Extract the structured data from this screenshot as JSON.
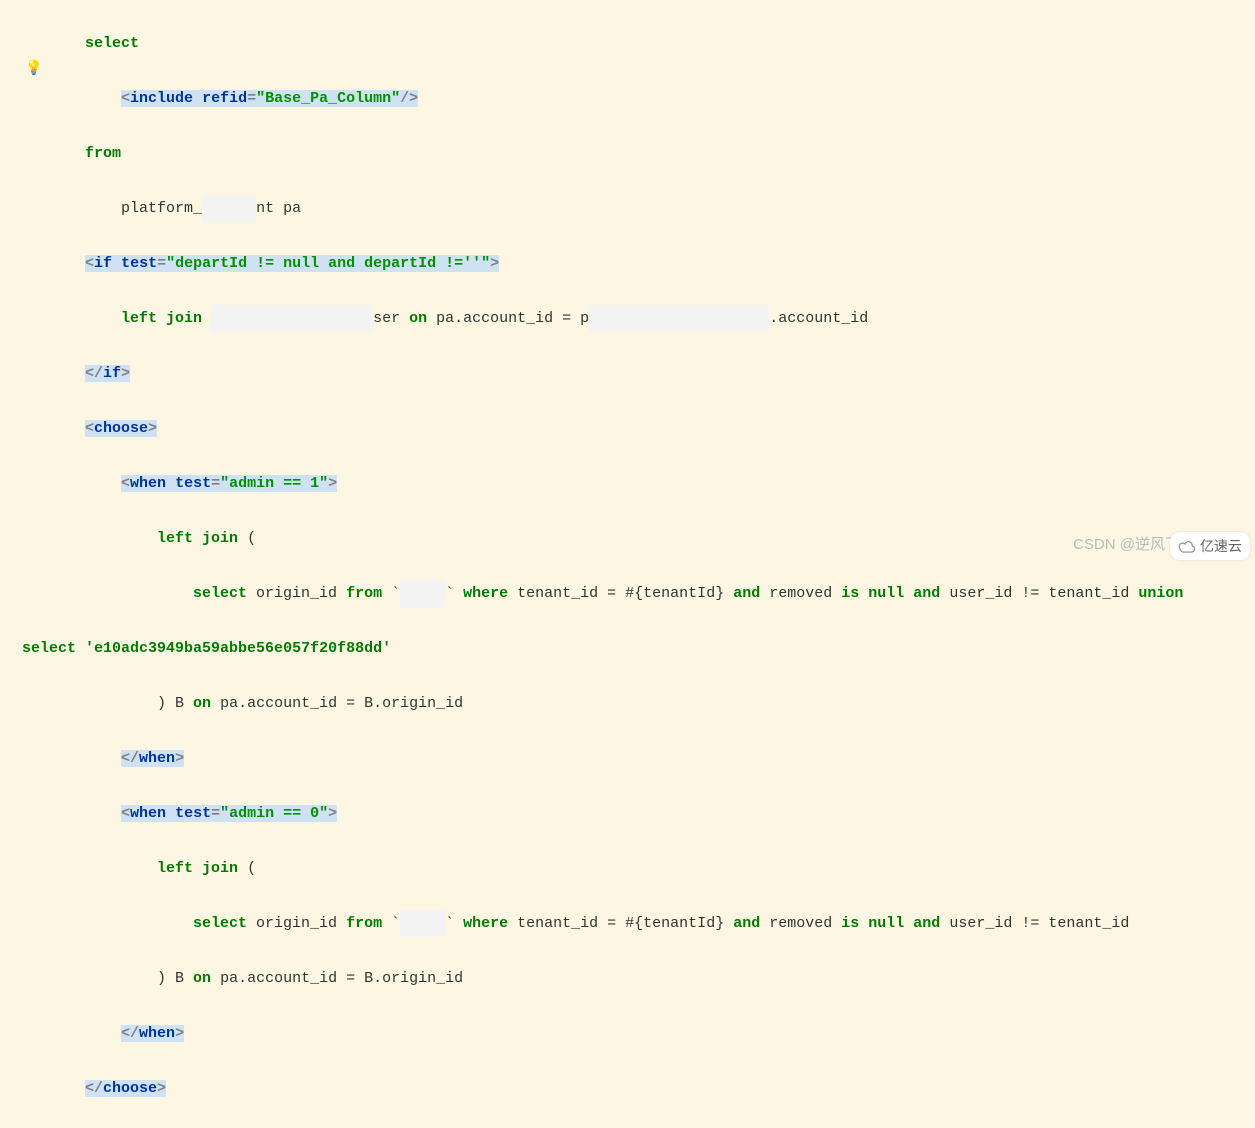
{
  "gutter": {
    "bulb": "💡"
  },
  "code": {
    "l1_select": "select",
    "l2_tag": "include",
    "l2_attr": "refid",
    "l2_val": "\"Base_Pa_Column\"",
    "l3_from": "from",
    "l4_pre": "platform_",
    "l4_red": "      ",
    "l4_post": "nt pa",
    "l5_tag": "if",
    "l5_attr": "test",
    "l5_val": "\"departId != null and departId !=''\"",
    "l6_lj": "left join",
    "l6_red1": "                  ",
    "l6_ser": "ser ",
    "l6_on": "on",
    "l6_mid": " pa.account_id = p",
    "l6_red2": "                    ",
    "l6_tail": ".account_id",
    "l7_tag": "if",
    "l8_tag": "choose",
    "l9_tag": "when",
    "l9_attr": "test",
    "l9_val": "\"admin == 1\"",
    "l10_lj": "left join",
    "l11_select": "select",
    "l11_t1": " origin_id ",
    "l11_from": "from",
    "l11_bt1": " `",
    "l11_red": "     ",
    "l11_bt2": "` ",
    "l11_where": "where",
    "l11_t2": " tenant_id = #{tenantId} ",
    "l11_and1": "and",
    "l11_t3": " removed ",
    "l11_is": "is",
    "l11_null": "null",
    "l11_and2": "and",
    "l11_t4": " user_id != tenant_id ",
    "l11_union": "union",
    "l12_select": "select",
    "l12_str": "'e10adc3949ba59abbe56e057f20f88dd'",
    "l13_t1": ") B ",
    "l13_on": "on",
    "l13_t2": " pa.account_id = B.origin_id",
    "l14_tag": "when",
    "l15_tag": "when",
    "l15_attr": "test",
    "l15_val": "\"admin == 0\"",
    "l16_lj": "left join",
    "l17_select": "select",
    "l17_t1": " origin_id ",
    "l17_from": "from",
    "l17_bt1": " `",
    "l17_red": "     ",
    "l17_bt2": "` ",
    "l17_where": "where",
    "l17_t2": " tenant_id = #{tenantId} ",
    "l17_and1": "and",
    "l17_t3": " removed ",
    "l17_is": "is",
    "l17_null": "null",
    "l17_and2": "and",
    "l17_t4": " user_id != tenant_id",
    "l18_t1": ") B ",
    "l18_on": "on",
    "l18_t2": " pa.account_id = B.origin_id",
    "l19_tag": "when",
    "l20_tag": "choose"
  },
  "watermark": "CSDN @逆风飞",
  "logo_text": "亿速云"
}
